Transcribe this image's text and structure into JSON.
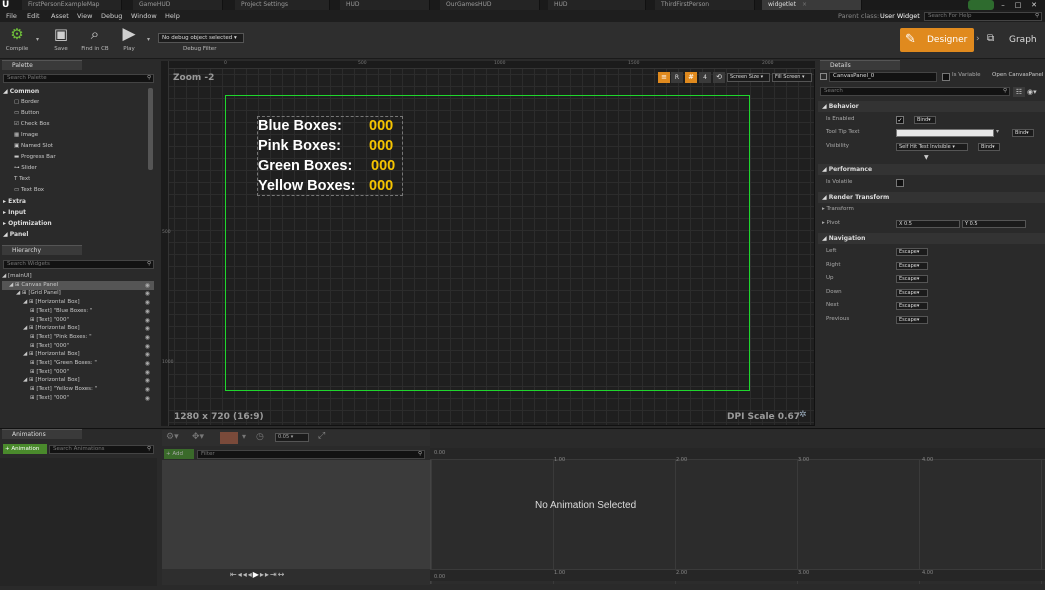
{
  "window": {
    "logo": "U",
    "tabs": [
      {
        "label": "FirstPersonExampleMap"
      },
      {
        "label": "GameHUD"
      },
      {
        "label": "Project Settings"
      },
      {
        "label": "HUD"
      },
      {
        "label": "OurGamesHUD"
      },
      {
        "label": "HUD"
      },
      {
        "label": "ThirdFirstPerson"
      },
      {
        "label": "widgetlet"
      }
    ],
    "tab_close": "×",
    "controls": {
      "minimize": "–",
      "maximize": "□",
      "close": "✕"
    }
  },
  "menu": {
    "items": [
      "File",
      "Edit",
      "Asset",
      "View",
      "Debug",
      "Window",
      "Help"
    ],
    "parent_class_label": "Parent class:",
    "parent_class_value": "User Widget",
    "search_placeholder": "Search For Help"
  },
  "toolbar": {
    "compile": "Compile",
    "save": "Save",
    "find_in_cb": "Find in CB",
    "play": "Play",
    "debug_object": "No debug object selected",
    "debug_filter": "Debug Filter",
    "designer": "Designer",
    "graph": "Graph"
  },
  "palette": {
    "tab": "Palette",
    "search_placeholder": "Search Palette",
    "categories": {
      "common": "Common",
      "extra": "Extra",
      "input": "Input",
      "optimization": "Optimization",
      "panel": "Panel"
    },
    "items": [
      "Border",
      "Button",
      "Check Box",
      "Image",
      "Named Slot",
      "Progress Bar",
      "Slider",
      "Text",
      "Text Box"
    ]
  },
  "hierarchy": {
    "tab": "Hierarchy",
    "search_placeholder": "Search Widgets",
    "rows": [
      {
        "label": "[mainUI]",
        "indent": 0
      },
      {
        "label": "Canvas Panel",
        "indent": 1,
        "selected": true
      },
      {
        "label": "[Grid Panel]",
        "indent": 2
      },
      {
        "label": "[Horizontal Box]",
        "indent": 3
      },
      {
        "label": "[Text] \"Blue Boxes: \"",
        "indent": 4
      },
      {
        "label": "[Text] \"000\"",
        "indent": 4
      },
      {
        "label": "[Horizontal Box]",
        "indent": 3
      },
      {
        "label": "[Text] \"Pink Boxes: \"",
        "indent": 4
      },
      {
        "label": "[Text] \"000\"",
        "indent": 4
      },
      {
        "label": "[Horizontal Box]",
        "indent": 3
      },
      {
        "label": "[Text] \"Green Boxes: \"",
        "indent": 4
      },
      {
        "label": "[Text] \"000\"",
        "indent": 4
      },
      {
        "label": "[Horizontal Box]",
        "indent": 3
      },
      {
        "label": "[Text] \"Yellow Boxes: \"",
        "indent": 4
      },
      {
        "label": "[Text] \"000\"",
        "indent": 4
      }
    ]
  },
  "viewport": {
    "zoom": "Zoom -2",
    "resolution": "1280 x 720 (16:9)",
    "dpi_scale": "DPI Scale 0.67",
    "screen_size": "Screen Size",
    "fill_screen": "Fill Screen",
    "r_btn": "R",
    "num_btn": "4",
    "ruler_top": [
      "0",
      "500",
      "1000",
      "1500",
      "2000"
    ],
    "ruler_left": [
      "500",
      "1000"
    ],
    "hud": [
      {
        "label": "Blue Boxes:",
        "value": "000"
      },
      {
        "label": "Pink Boxes:",
        "value": "000"
      },
      {
        "label": "Green Boxes:",
        "value": "000"
      },
      {
        "label": "Yellow Boxes:",
        "value": "000"
      }
    ]
  },
  "details": {
    "tab": "Details",
    "name_value": "CanvasPanel_0",
    "is_variable": "Is Variable",
    "open_link": "Open CanvasPanel",
    "search_placeholder": "Search",
    "sections": {
      "behavior": "Behavior",
      "performance": "Performance",
      "render_transform": "Render Transform",
      "navigation": "Navigation"
    },
    "behavior": {
      "is_enabled": "Is Enabled",
      "tool_tip_text": "Tool Tip Text",
      "visibility": "Visibility",
      "visibility_value": "Self Hit Test Invisible",
      "bind": "Bind"
    },
    "performance": {
      "is_volatile": "Is Volatile"
    },
    "render_transform": {
      "transform": "Transform",
      "pivot": "Pivot",
      "pivot_x": "0.5",
      "pivot_y": "0.5"
    },
    "navigation": [
      {
        "label": "Left",
        "value": "Escape"
      },
      {
        "label": "Right",
        "value": "Escape"
      },
      {
        "label": "Up",
        "value": "Escape"
      },
      {
        "label": "Down",
        "value": "Escape"
      },
      {
        "label": "Next",
        "value": "Escape"
      },
      {
        "label": "Previous",
        "value": "Escape"
      }
    ]
  },
  "animations": {
    "tab": "Animations",
    "add_button": "+ Animation",
    "search_placeholder": "Search Animations",
    "add_track": "+ Add",
    "filter_placeholder": "Filter",
    "time_value": "0.05",
    "no_selection": "No Animation Selected",
    "timeline_top": [
      "0.00",
      "1.00",
      "2.00",
      "3.00",
      "4.00"
    ],
    "timeline_bottom": [
      "0.00",
      "1.00",
      "2.00",
      "3.00",
      "4.00"
    ]
  }
}
